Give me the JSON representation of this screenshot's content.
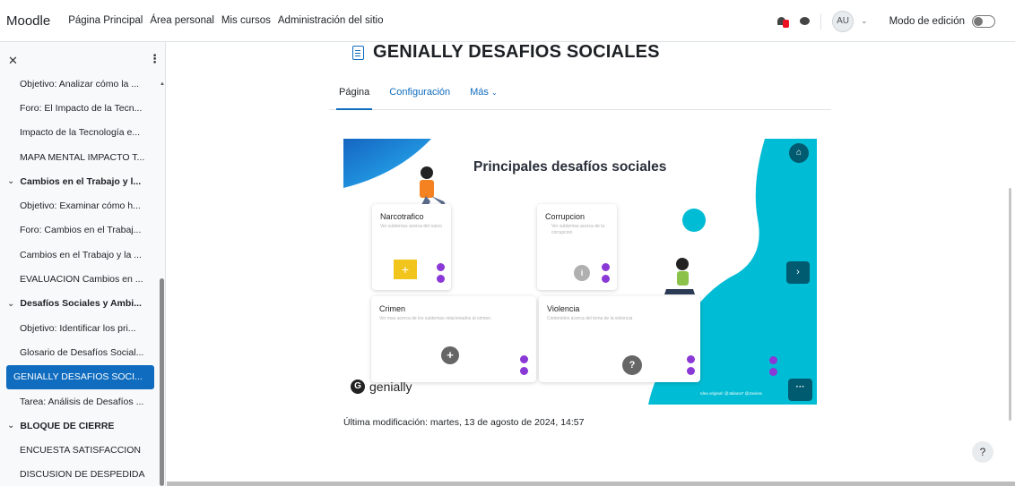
{
  "navbar": {
    "brand": "Moodle",
    "links": [
      "Página Principal",
      "Área personal",
      "Mis cursos",
      "Administración del sitio"
    ],
    "user_initials": "AU",
    "edit_mode_label": "Modo de edición"
  },
  "drawer": {
    "items": [
      {
        "label": "Objetivo: Analizar cómo la ...",
        "kind": "item"
      },
      {
        "label": "Foro: El Impacto de la Tecn...",
        "kind": "item"
      },
      {
        "label": "Impacto de la Tecnología e...",
        "kind": "item"
      },
      {
        "label": "MAPA MENTAL IMPACTO T...",
        "kind": "item"
      },
      {
        "label": "Cambios en el Trabajo y l...",
        "kind": "section"
      },
      {
        "label": "Objetivo: Examinar cómo h...",
        "kind": "item"
      },
      {
        "label": "Foro: Cambios en el Trabaj...",
        "kind": "item"
      },
      {
        "label": "Cambios en el Trabajo y la ...",
        "kind": "item"
      },
      {
        "label": "EVALUACION Cambios en ...",
        "kind": "item"
      },
      {
        "label": "Desafíos Sociales y Ambi...",
        "kind": "section"
      },
      {
        "label": "Objetivo: Identificar los pri...",
        "kind": "item"
      },
      {
        "label": "Glosario de Desafíos Social...",
        "kind": "item"
      },
      {
        "label": "GENIALLY DESAFIOS SOCI...",
        "kind": "active"
      },
      {
        "label": "Tarea: Análisis de Desafíos ...",
        "kind": "item"
      },
      {
        "label": "BLOQUE DE CIERRE",
        "kind": "section"
      },
      {
        "label": "ENCUESTA SATISFACCION",
        "kind": "item"
      },
      {
        "label": "DISCUSION DE DESPEDIDA",
        "kind": "item"
      }
    ]
  },
  "main": {
    "title": "GENIALLY DESAFIOS SOCIALES",
    "tabs": {
      "page": "Página",
      "settings": "Configuración",
      "more": "Más"
    },
    "last_modified": "Última modificación: martes, 13 de agosto de 2024, 14:57"
  },
  "genially": {
    "heading": "Principales desafíos sociales",
    "cards": {
      "narco": {
        "title": "Narcotrafico",
        "subtitle": "Ver subtemas acerca del narco"
      },
      "corrupcion": {
        "title": "Corrupcion",
        "subtitle": "Ver subtemas acerca de la corrupcion"
      },
      "crimen": {
        "title": "Crimen",
        "subtitle": "Ver mas acerca de los subtemas relacionados al crimen."
      },
      "violencia": {
        "title": "Violencia",
        "subtitle": "Contenidos acerca del tema de la violencia"
      }
    },
    "logo_text": "genially",
    "credit": "Idea original: @Jaliana7 @Javiera"
  },
  "colors": {
    "accent": "#0f6cbf",
    "teal": "#00bcd4",
    "genially_dark": "#005a70",
    "purple": "#8a38d6",
    "yellow": "#f2c51d"
  }
}
